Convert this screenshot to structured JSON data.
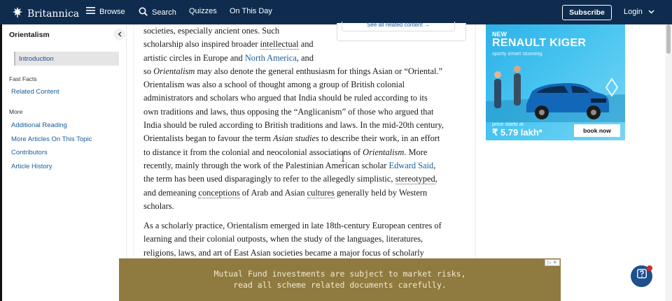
{
  "topbar": {
    "logo_text": "Britannica",
    "browse": "Browse",
    "search": "Search",
    "quizzes": "Quizzes",
    "on_this_day": "On This Day",
    "subscribe": "Subscribe",
    "login": "Login"
  },
  "sidebar": {
    "title": "Orientalism",
    "active_item": "Introduction",
    "fast_facts_label": "Fast Facts",
    "related_content": "Related Content",
    "more_label": "More",
    "links": [
      "Additional Reading",
      "More Articles On This Topic",
      "Contributors",
      "Article History"
    ]
  },
  "article": {
    "related_box": "See all related content →",
    "p1": {
      "l1": "societies, especially ancient ones. Such",
      "l2a": "scholarship also inspired broader ",
      "l2b": "intellectual",
      "l2c": " and",
      "l3a": "artistic circles in Europe and ",
      "l3b": "North America",
      "l3c": ", and",
      "l4a": "so ",
      "l4b": "Orientalism",
      "l4c": " may also denote the general enthusiasm for things Asian or “Oriental.”",
      "l5": "Orientalism was also a school of thought among a group of British colonial",
      "l6": "administrators and scholars who argued that India should be ruled according to its",
      "l7": "own traditions and laws, thus opposing the “Anglicanism” of those who argued that",
      "l8": "India should be ruled according to British traditions and laws. In the mid-20th century,",
      "l9a": "Orientalists began to favour the term ",
      "l9b": "Asian studies",
      "l9c": " to describe their work, in an effort",
      "l10a": "to distance it from the colonial and neocolonial associations of ",
      "l10b": "Orientalism",
      "l10c": ". More",
      "l11a": "recently, mainly through the work of the Palestinian American scholar ",
      "l11b": "Edward Said",
      "l11c": ",",
      "l12a": "the term has been used disparagingly to refer to the allegedly simplistic, ",
      "l12b": "stereotyped",
      "l12c": ",",
      "l13a": "and demeaning ",
      "l13b": "conceptions",
      "l13c": " of Arab and Asian ",
      "l13d": "cultures",
      "l13e": " generally held by Western",
      "l14": "scholars."
    },
    "p2": {
      "l1": "As a scholarly practice, Orientalism emerged in late 18th-century European centres of",
      "l2": "learning and their colonial outposts, when the study of the languages, literatures,",
      "l3": "religions, laws, and art of East Asian societies became a major focus of scholarly"
    }
  },
  "ad": {
    "new": "NEW",
    "model": "RENAULT KIGER",
    "tagline": "sporty smart stunning",
    "price_label": "price starts at",
    "price": "₹ 5.79 lakh*",
    "cta": "book now",
    "accent": "#2eb1e8"
  },
  "banner": {
    "line1": "Mutual Fund investments are subject to market risks,",
    "line2": "read all scheme related documents carefully.",
    "adx": "▷ ✕"
  },
  "colors": {
    "nav_bg": "#0f2c4f",
    "link": "#1a5b9a",
    "banner_bg": "#8f7a3f",
    "help_bg": "#1f4f8d"
  }
}
